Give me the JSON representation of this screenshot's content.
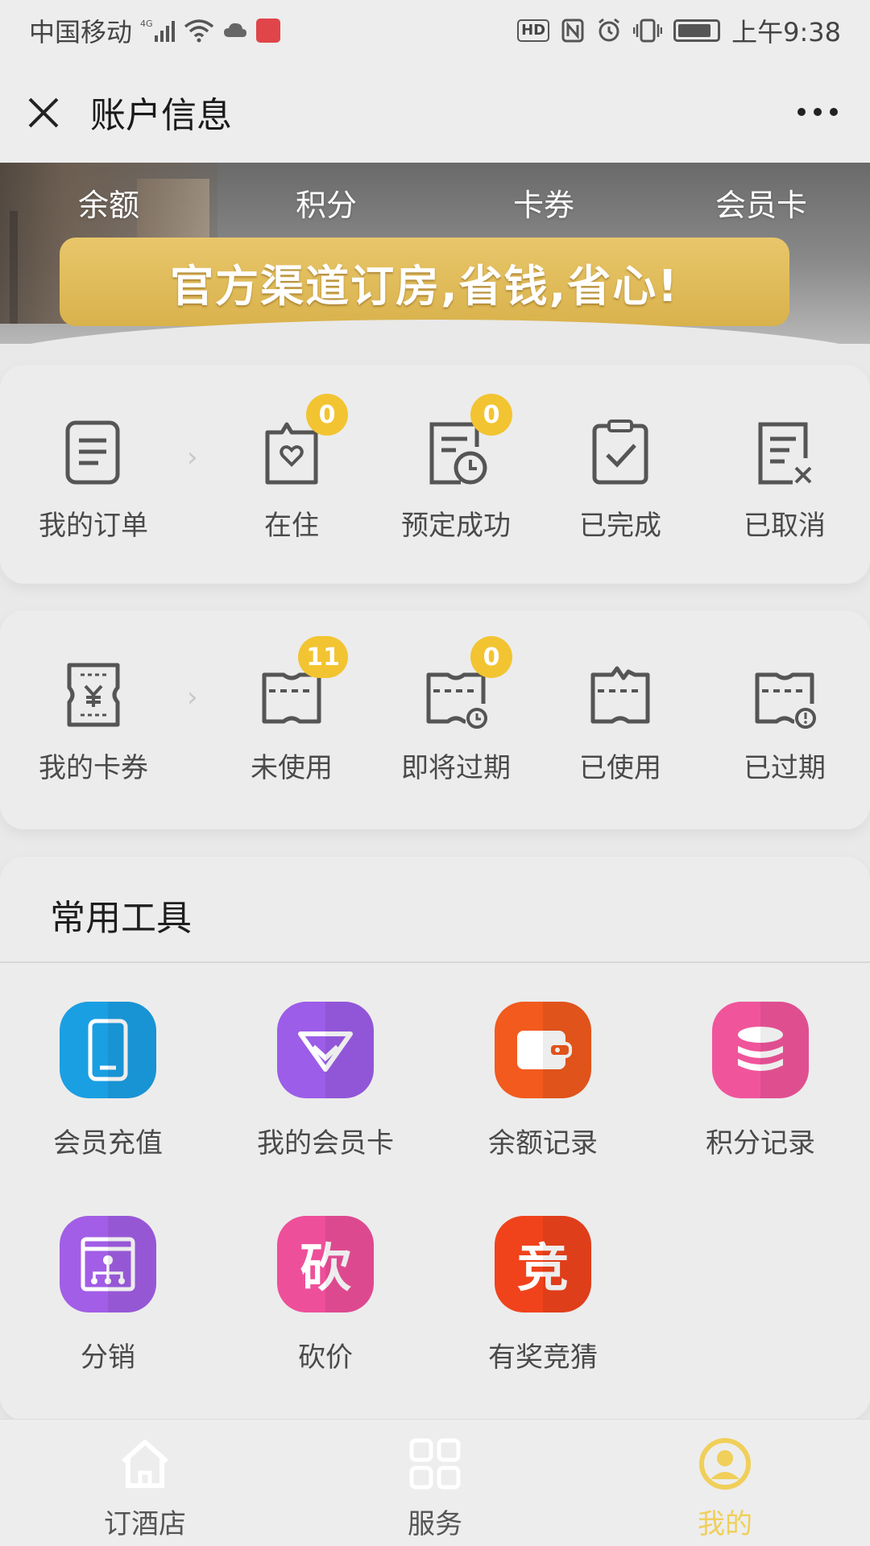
{
  "status_bar": {
    "carrier": "中国移动",
    "network": "4G",
    "time": "上午9:38",
    "hd_label": "HD"
  },
  "nav": {
    "title": "账户信息"
  },
  "hero": {
    "tabs": [
      "余额",
      "积分",
      "卡券",
      "会员卡"
    ],
    "banner_text": "官方渠道订房,省钱,省心!"
  },
  "orders": {
    "main_label": "我的订单",
    "items": [
      {
        "label": "在住",
        "badge": "0"
      },
      {
        "label": "预定成功",
        "badge": "0"
      },
      {
        "label": "已完成"
      },
      {
        "label": "已取消"
      }
    ]
  },
  "coupons": {
    "main_label": "我的卡券",
    "items": [
      {
        "label": "未使用",
        "badge": "11"
      },
      {
        "label": "即将过期",
        "badge": "0"
      },
      {
        "label": "已使用"
      },
      {
        "label": "已过期"
      }
    ]
  },
  "tools": {
    "title": "常用工具",
    "items": [
      {
        "label": "会员充值",
        "color": "#1a9fe3"
      },
      {
        "label": "我的会员卡",
        "color": "#9c5de8"
      },
      {
        "label": "余额记录",
        "color": "#f25a1e"
      },
      {
        "label": "积分记录",
        "color": "#f0559b"
      },
      {
        "label": "分销",
        "color": "#a25ee6"
      },
      {
        "label": "砍价",
        "glyph": "砍",
        "color": "#ee4f9a"
      },
      {
        "label": "有奖竞猜",
        "glyph": "竞",
        "color": "#f0431c"
      }
    ]
  },
  "tab_bar": {
    "items": [
      {
        "label": "订酒店"
      },
      {
        "label": "服务"
      },
      {
        "label": "我的"
      }
    ],
    "active_color": "#f0cf5a"
  }
}
